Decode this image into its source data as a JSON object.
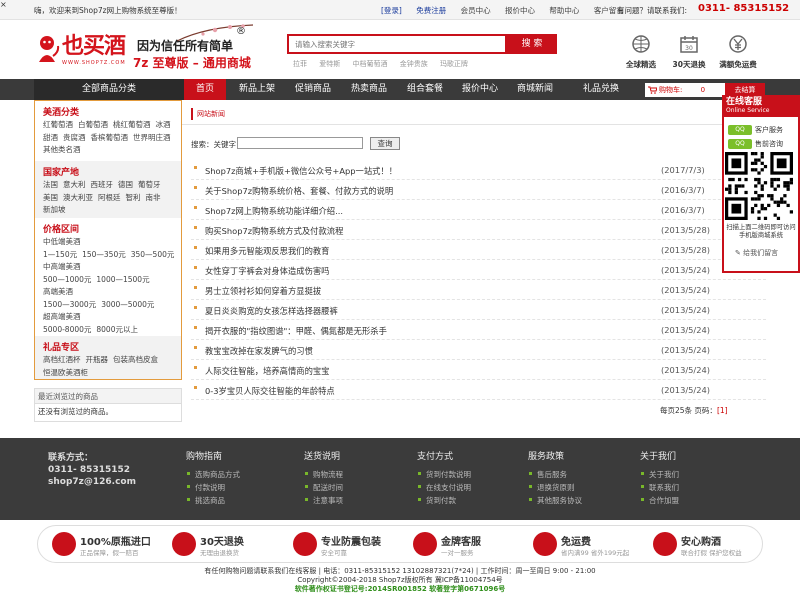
{
  "topbar": {
    "welcome": "嗨，欢迎来到Shop7z网上购物系统至尊版！",
    "links": [
      "[登录]",
      "免费注册",
      "会员中心",
      "报价中心",
      "帮助中心",
      "客户留言"
    ],
    "hotline_label": "有问题？请联系我们:",
    "hotline": "0311- 85315152"
  },
  "header": {
    "logo_text": "也买酒",
    "logo_url": "WWW.SHOP7Z.COM",
    "slogan1": "因为信任所有简单",
    "slogan_mark": "®",
    "slogan2": "7z 至尊版 – 通用商城",
    "search_placeholder": "请输入搜索关键字",
    "search_btn": "搜 索",
    "hotwords": [
      "拉菲",
      "爱特斯",
      "中档葡萄酒",
      "金钟贵族",
      "玛歌正牌"
    ],
    "services": [
      {
        "label": "全球精选",
        "icon": "globe-icon"
      },
      {
        "label": "30天退换",
        "icon": "calendar-icon"
      },
      {
        "label": "满额免运费",
        "icon": "yen-icon"
      }
    ]
  },
  "nav": {
    "all_categories": "全部商品分类",
    "items": [
      "首页",
      "新品上架",
      "促销商品",
      "热卖商品",
      "组合套餐",
      "报价中心",
      "商城新闻",
      "礼品兑换"
    ],
    "cart_label": "购物车:",
    "cart_count": "0",
    "checkout": "去结算"
  },
  "sidebar": {
    "categories": [
      {
        "title": "美酒分类",
        "lines": [
          [
            "红葡萄酒",
            "白葡萄酒",
            "桃红葡萄酒",
            "冰酒"
          ],
          [
            "甜酒",
            "贵腐酒",
            "香槟葡萄酒",
            "世界明庄酒"
          ],
          [
            "其他类名酒"
          ]
        ]
      },
      {
        "title": "国家产地",
        "lines": [
          [
            "法国",
            "意大利",
            "西班牙",
            "德国",
            "葡萄牙"
          ],
          [
            "美国",
            "澳大利亚",
            "阿根廷",
            "智利",
            "南非"
          ],
          [
            "新加坡"
          ]
        ]
      },
      {
        "title": "价格区间",
        "lines": [
          [
            "中低端美酒"
          ],
          [
            "1—150元",
            "150—350元",
            "350—500元"
          ],
          [
            "中高端美酒"
          ],
          [
            "500—1000元",
            "1000—1500元"
          ],
          [
            "高端美酒"
          ],
          [
            "1500—3000元",
            "3000—5000元"
          ],
          [
            "超高端美酒"
          ],
          [
            "5000-8000元",
            "8000元以上"
          ]
        ]
      },
      {
        "title": "礼品专区",
        "lines": [
          [
            "高档红酒杯",
            "开瓶器",
            "包装高档皮盒"
          ],
          [
            "恒温欧美酒柜"
          ]
        ]
      }
    ],
    "recent_title": "最近浏览过的商品",
    "recent_body": "还没有浏览过的商品。"
  },
  "content": {
    "tab": "网站新闻",
    "search_label": "搜索：关键字",
    "search_btn": "查询",
    "news": [
      {
        "title": "Shop7z商城+手机版+微信公众号+App一站式！！",
        "date": "(2017/7/3)"
      },
      {
        "title": "关于Shop7z购物系统价格、套餐、付款方式的说明",
        "date": "(2016/3/7)"
      },
      {
        "title": "Shop7z网上购物系统功能详细介绍...",
        "date": "(2016/3/7)"
      },
      {
        "title": "购买Shop7z购物系统方式及付款流程",
        "date": "(2013/5/28)"
      },
      {
        "title": "如果用多元智能观反思我们的教育",
        "date": "(2013/5/28)"
      },
      {
        "title": "女性穿丁字裤会对身体造成伤害吗",
        "date": "(2013/5/24)"
      },
      {
        "title": "男士立领衬衫如何穿着方显挺拔",
        "date": "(2013/5/24)"
      },
      {
        "title": "夏日炎炎购宽的女孩怎样选择器腰裤",
        "date": "(2013/5/24)"
      },
      {
        "title": "揭开衣服的\"指纹图谱\"：甲醛、偶氮都是无形杀手",
        "date": "(2013/5/24)"
      },
      {
        "title": "教宝宝改掉在家发脾气的习惯",
        "date": "(2013/5/24)"
      },
      {
        "title": "人际交往智能，培养高情商的宝宝",
        "date": "(2013/5/24)"
      },
      {
        "title": "0-3岁宝贝人际交往智能的年龄特点",
        "date": "(2013/5/24)"
      }
    ],
    "pager_text": "每页25条 页码：",
    "pager_current": "[1]"
  },
  "footer": {
    "contact_label": "联系方式：",
    "contact_phone": "0311- 85315152",
    "contact_email": "shop7z@126.com",
    "columns": [
      {
        "title": "购物指南",
        "items": [
          "选购商品方式",
          "付款说明",
          "挑选商品"
        ]
      },
      {
        "title": "送货说明",
        "items": [
          "购物流程",
          "配送时间",
          "注意事项"
        ]
      },
      {
        "title": "支付方式",
        "items": [
          "货到付款说明",
          "在线支付说明",
          "货到付款"
        ]
      },
      {
        "title": "服务政策",
        "items": [
          "售后服务",
          "退换货原则",
          "其他服务协议"
        ]
      },
      {
        "title": "关于我们",
        "items": [
          "关于我们",
          "联系我们",
          "合作加盟"
        ]
      }
    ],
    "badges": [
      {
        "name": "100%原瓶进口",
        "sub": "正品保障，假一赔百"
      },
      {
        "name": "30天退换",
        "sub": "无理由退换货"
      },
      {
        "name": "专业防震包装",
        "sub": "安全可靠"
      },
      {
        "name": "金牌客服",
        "sub": "一对一服务"
      },
      {
        "name": "免运费",
        "sub": "省内满99 省外199元起"
      },
      {
        "name": "安心购酒",
        "sub": "联合打假 保护您权益"
      }
    ],
    "copy1": "有任何购物问题请联系我们在线客服 | 电话：0311-85315152 13102887321(7*24) | 工作时间：周一至周日 9:00 - 21:00",
    "copy2": "Copyright©2004-2018 Shop7z版权所有 冀ICP备11004754号",
    "copy3": "软件著作权证书登记号:2014SR001852 软著登字第0671096号"
  },
  "service": {
    "title": "在线客服",
    "subtitle": "Online Service",
    "qq1": "客户服务",
    "qq2": "售前咨询",
    "qq_badge": "QQ",
    "note": "扫描上面二维码即可访问手机版商城系统",
    "message": "给我们留言"
  },
  "colors": {
    "accent": "#c8101a",
    "nav_bg": "#3a3a3a",
    "footer_bg": "#3b3b3b",
    "sidebar_border": "#e39b3d",
    "green": "#7bbf2a"
  }
}
